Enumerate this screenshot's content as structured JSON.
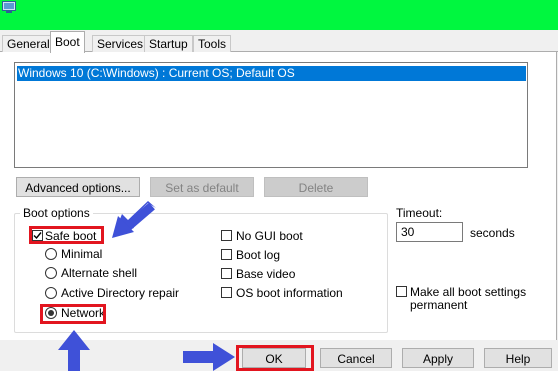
{
  "tabs": [
    "General",
    "Boot",
    "Services",
    "Startup",
    "Tools"
  ],
  "os_list": {
    "items": [
      "Windows 10 (C:\\Windows) : Current OS; Default OS"
    ]
  },
  "buttons": {
    "advanced": "Advanced options...",
    "set_default": "Set as default",
    "delete": "Delete",
    "ok": "OK",
    "cancel": "Cancel",
    "apply": "Apply",
    "help": "Help"
  },
  "boot_options": {
    "legend": "Boot options",
    "safe_boot": {
      "label": "Safe boot",
      "checked": true
    },
    "radios": [
      {
        "label": "Minimal",
        "checked": false
      },
      {
        "label": "Alternate shell",
        "checked": false
      },
      {
        "label": "Active Directory repair",
        "checked": false
      },
      {
        "label": "Network",
        "checked": true
      }
    ],
    "right_checks": [
      {
        "label": "No GUI boot",
        "checked": false
      },
      {
        "label": "Boot log",
        "checked": false
      },
      {
        "label": "Base video",
        "checked": false
      },
      {
        "label": "OS boot information",
        "checked": false
      }
    ]
  },
  "timeout": {
    "label": "Timeout:",
    "value": "30",
    "unit": "seconds"
  },
  "permanent": {
    "line1": "Make all boot settings",
    "line2": "permanent",
    "checked": false
  },
  "colors": {
    "title_bar": "#00f73f",
    "selection": "#0078d7",
    "highlight": "#e2151f",
    "arrow": "#3f51d8"
  }
}
